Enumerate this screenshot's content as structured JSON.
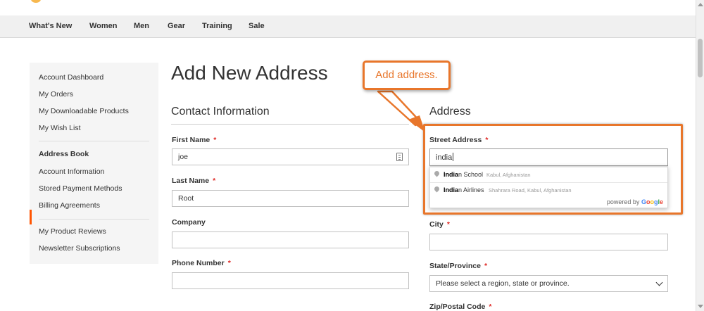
{
  "nav": {
    "items": [
      "What's New",
      "Women",
      "Men",
      "Gear",
      "Training",
      "Sale"
    ]
  },
  "sidebar": {
    "items": [
      {
        "label": "Account Dashboard",
        "active": false
      },
      {
        "label": "My Orders",
        "active": false
      },
      {
        "label": "My Downloadable Products",
        "active": false
      },
      {
        "label": "My Wish List",
        "active": false
      },
      {
        "label": "Address Book",
        "active": true
      },
      {
        "label": "Account Information",
        "active": false
      },
      {
        "label": "Stored Payment Methods",
        "active": false
      },
      {
        "label": "Billing Agreements",
        "active": false
      },
      {
        "label": "My Product Reviews",
        "active": false
      },
      {
        "label": "Newsletter Subscriptions",
        "active": false
      }
    ],
    "active_color": "#ff5501"
  },
  "page": {
    "title": "Add New Address"
  },
  "contact": {
    "heading": "Contact Information",
    "first_name_label": "First Name",
    "first_name_value": "joe",
    "last_name_label": "Last Name",
    "last_name_value": "Root",
    "company_label": "Company",
    "company_value": "",
    "phone_label": "Phone Number",
    "phone_value": "",
    "required_mark": "*"
  },
  "address": {
    "heading": "Address",
    "street_label": "Street Address",
    "street_value": "india",
    "city_label": "City",
    "city_value": "",
    "state_label": "State/Province",
    "state_value": "Please select a region, state or province.",
    "zip_label": "Zip/Postal Code"
  },
  "autocomplete": {
    "suggestions": [
      {
        "match": "India",
        "rest": "n School",
        "secondary": "Kabul, Afghanistan"
      },
      {
        "match": "India",
        "rest": "n Airlines",
        "secondary": "Shahrara Road, Kabul, Afghanistan"
      }
    ],
    "powered_by": "powered by",
    "google_letters": [
      "G",
      "o",
      "o",
      "g",
      "l",
      "e"
    ]
  },
  "annotation": {
    "callout_text": "Add address.",
    "color": "#e8762b"
  },
  "icons": {
    "autofill": "card-icon",
    "pin": "map-pin-icon",
    "chevron": "chevron-down-icon"
  }
}
